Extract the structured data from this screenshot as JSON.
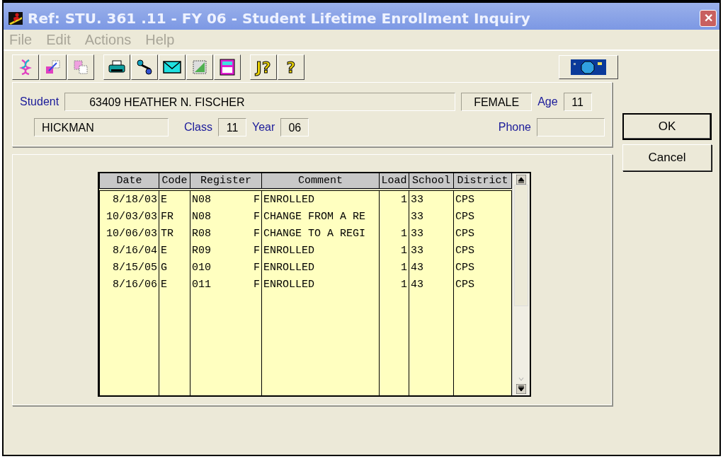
{
  "window": {
    "title": "Ref: STU. 361 .11 - FY 06 - Student Lifetime Enrollment Inquiry",
    "close": "✕"
  },
  "menu": [
    {
      "label": "File",
      "disabled": true
    },
    {
      "label": "Edit",
      "disabled": true
    },
    {
      "label": "Actions",
      "disabled": true
    },
    {
      "label": "Help",
      "disabled": true
    }
  ],
  "toolbar": [
    {
      "kind": "dna"
    },
    {
      "kind": "resize"
    },
    {
      "kind": "copy"
    },
    {
      "kind": "gap"
    },
    {
      "kind": "printer"
    },
    {
      "kind": "tools"
    },
    {
      "kind": "envelope"
    },
    {
      "kind": "note"
    },
    {
      "kind": "calculator"
    },
    {
      "kind": "gap"
    },
    {
      "kind": "jhelp",
      "text": "J?"
    },
    {
      "kind": "help",
      "text": "?"
    }
  ],
  "student": {
    "label": "Student",
    "value": "63409 HEATHER N. FISCHER",
    "gender": "FEMALE",
    "age_label": "Age",
    "age": "11",
    "school": "HICKMAN",
    "class_label": "Class",
    "class": "11",
    "year_label": "Year",
    "year": "06",
    "phone_label": "Phone"
  },
  "buttons": [
    {
      "label": "OK",
      "default": true
    },
    {
      "label": "Cancel",
      "default": false
    }
  ],
  "table": {
    "columns": [
      "Date",
      "Code",
      "Register",
      "Comment",
      "Load",
      "School",
      "District"
    ],
    "rows": [
      {
        "date": "8/18/03",
        "code": "E",
        "register": "N08",
        "flag": "F",
        "comment": "ENROLLED",
        "load": "1",
        "school": "33",
        "district": "CPS"
      },
      {
        "date": "10/03/03",
        "code": "FR",
        "register": "N08",
        "flag": "F",
        "comment": "CHANGE FROM A RE",
        "school": "33",
        "district": "CPS"
      },
      {
        "date": "10/06/03",
        "code": "TR",
        "register": "R08",
        "flag": "F",
        "comment": "CHANGE TO A REGI",
        "load": "1",
        "school": "33",
        "district": "CPS"
      },
      {
        "date": "8/16/04",
        "code": "E",
        "register": "R09",
        "flag": "F",
        "comment": "ENROLLED",
        "load": "1",
        "school": "33",
        "district": "CPS"
      },
      {
        "date": "8/15/05",
        "code": "G",
        "register": "010",
        "flag": "F",
        "comment": "ENROLLED",
        "load": "1",
        "school": "43",
        "district": "CPS"
      },
      {
        "date": "8/16/06",
        "code": "E",
        "register": "011",
        "flag": "F",
        "comment": "ENROLLED",
        "load": "1",
        "school": "43",
        "district": "CPS"
      }
    ]
  }
}
